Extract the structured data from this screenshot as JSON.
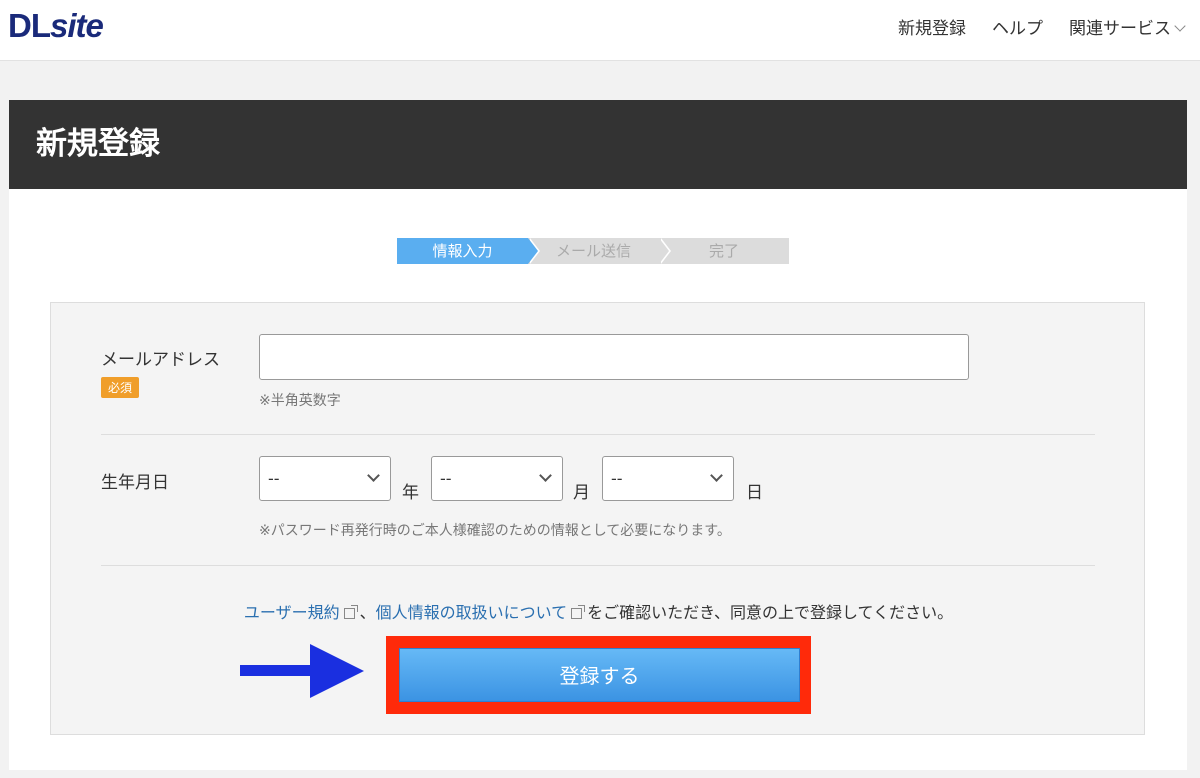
{
  "header": {
    "logo_main": "DL",
    "logo_rest": "site",
    "nav": {
      "register": "新規登録",
      "help": "ヘルプ",
      "services": "関連サービス"
    }
  },
  "page": {
    "title": "新規登録"
  },
  "steps": [
    "情報入力",
    "メール送信",
    "完了"
  ],
  "form": {
    "email_label": "メールアドレス",
    "required_badge": "必須",
    "email_value": "",
    "email_hint": "※半角英数字",
    "birthday_label": "生年月日",
    "year_value": "--",
    "year_unit": "年",
    "month_value": "--",
    "month_unit": "月",
    "day_value": "--",
    "day_unit": "日",
    "birthday_hint": "※パスワード再発行時のご本人様確認のための情報として必要になります。"
  },
  "agreement": {
    "terms_link": "ユーザー規約",
    "separator": "、",
    "privacy_link": "個人情報の取扱いについて",
    "suffix": "をご確認いただき、同意の上で登録してください。"
  },
  "submit_label": "登録する",
  "colors": {
    "accent": "#5aaef0",
    "highlight": "#ff2a0a",
    "annotation_arrow": "#1a2fe0",
    "badge": "#f09e2a"
  }
}
